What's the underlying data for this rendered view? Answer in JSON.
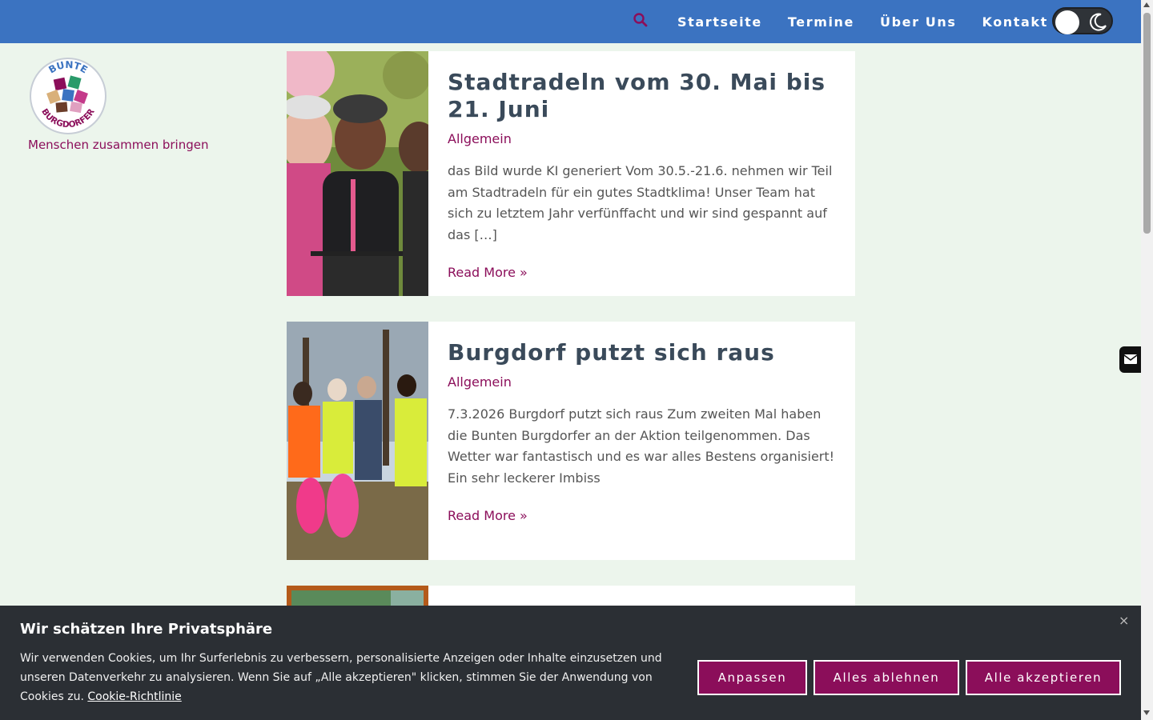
{
  "header": {
    "nav": [
      "Startseite",
      "Termine",
      "Über Uns",
      "Kontakt"
    ],
    "search_icon": "search-icon",
    "theme_toggle_icon": "moon-icon",
    "colors": {
      "bar": "#3b73c1",
      "accent": "#8b0e5a"
    }
  },
  "site": {
    "logo_text_top": "BUNTE",
    "logo_text_bottom": "BURGDORFER",
    "tagline": "Menschen zusammen bringen"
  },
  "posts": [
    {
      "title": "Stadtradeln vom 30. Mai bis 21. Juni",
      "category": "Allgemein",
      "excerpt": "das Bild wurde KI generiert Vom 30.5.-21.6. nehmen wir Teil am Stadtradeln für ein gutes Stadtklima! Unser Team hat sich zu letztem Jahr verfünffacht und wir sind gespannt auf das […]",
      "read_more": "Read More »"
    },
    {
      "title": "Burgdorf putzt sich raus",
      "category": "Allgemein",
      "excerpt": "7.3.2026 Burgdorf putzt sich raus Zum zweiten Mal haben die Bunten Burgdorfer an der Aktion teilgenommen. Das Wetter war fantastisch und es war alles Bestens organisiert! Ein sehr leckerer Imbiss",
      "read_more": "Read More »"
    }
  ],
  "cookie": {
    "title": "Wir schätzen Ihre Privatsphäre",
    "text": "Wir verwenden Cookies, um Ihr Surferlebnis zu verbessern, personalisierte Anzeigen oder Inhalte einzusetzen und unseren Datenverkehr zu analysieren. Wenn Sie auf „Alle akzeptieren\" klicken, stimmen Sie der Anwendung von Cookies zu.",
    "policy_link": "Cookie-Richtlinie",
    "buttons": {
      "customize": "Anpassen",
      "reject": "Alles ablehnen",
      "accept": "Alle akzeptieren"
    },
    "close": "×"
  }
}
